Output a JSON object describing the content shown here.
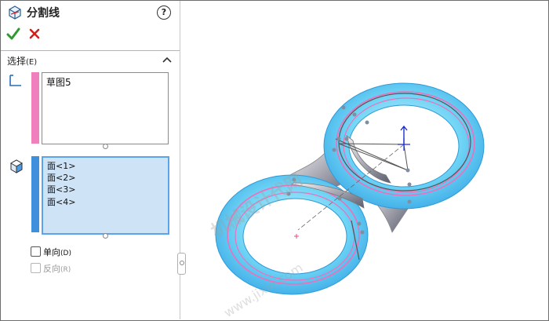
{
  "panel": {
    "title": "分割线",
    "help": "?",
    "ok_icon": "check-icon",
    "cancel_icon": "close-icon",
    "section": {
      "label": "选择",
      "hotkey": "(E)"
    },
    "selection_1": {
      "items": [
        "草图5"
      ],
      "color": "#f07fbe"
    },
    "selection_2": {
      "items": [
        "面<1>",
        "面<2>",
        "面<3>",
        "面<4>"
      ],
      "color": "#3f8fdc"
    },
    "options": [
      {
        "label": "单向",
        "hotkey": "(D)",
        "checked": false,
        "enabled": true
      },
      {
        "label": "反向",
        "hotkey": "(R)",
        "checked": false,
        "enabled": false
      }
    ]
  },
  "viewport": {
    "model_color": "#6fd4f5",
    "split_line_color": "#f06fbd",
    "watermark": "机械设计代网",
    "watermark_url": "www.jixie.com"
  }
}
